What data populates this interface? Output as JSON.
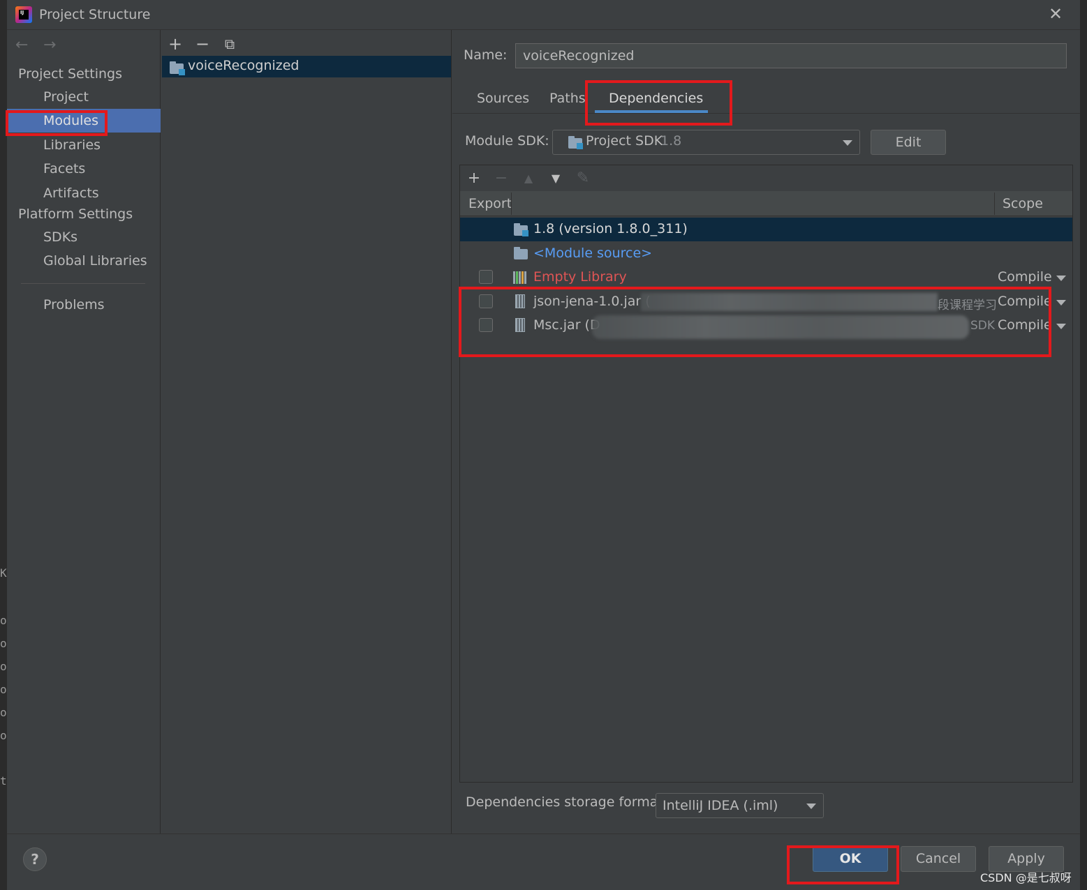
{
  "window": {
    "title": "Project Structure",
    "close_symbol": "✕"
  },
  "nav": {
    "back_symbol": "←",
    "forward_symbol": "→",
    "project_settings_header": "Project Settings",
    "project_settings_items": [
      "Project",
      "Modules",
      "Libraries",
      "Facets",
      "Artifacts"
    ],
    "platform_settings_header": "Platform Settings",
    "platform_settings_items": [
      "SDKs",
      "Global Libraries"
    ],
    "problems": "Problems",
    "selected_item": "Modules"
  },
  "modules_pane": {
    "toolbar": {
      "add_symbol": "+",
      "remove_symbol": "−",
      "copy_symbol": "⧉"
    },
    "tree": [
      {
        "label": "voiceRecognized",
        "selected": true
      }
    ]
  },
  "module": {
    "name_label": "Name:",
    "name_value": "voiceRecognized",
    "tabs": [
      "Sources",
      "Paths",
      "Dependencies"
    ],
    "active_tab": "Dependencies",
    "sdk_label": "Module SDK:",
    "sdk_value": "Project SDK",
    "sdk_version": "1.8",
    "edit_button": "Edit"
  },
  "dependencies": {
    "toolbar": {
      "add": "+",
      "remove": "−",
      "up": "▲",
      "down": "▼",
      "edit": "✎"
    },
    "columns": [
      "Export",
      "Scope"
    ],
    "rows": [
      {
        "label": "1.8 (version 1.8.0_311)",
        "type": "sdk",
        "checkbox": false,
        "scope": "",
        "selected": true
      },
      {
        "label": "<Module source>",
        "type": "source",
        "checkbox": false,
        "scope": ""
      },
      {
        "label": "Empty Library",
        "type": "library",
        "checkbox": true,
        "scope": "Compile"
      },
      {
        "label": "json-jena-1.0.jar (",
        "type": "jar",
        "checkbox": true,
        "scope": "Compile",
        "path_tail": "段课程学习"
      },
      {
        "label": "Msc.jar (D",
        "type": "jar",
        "checkbox": true,
        "scope": "Compile",
        "path_tail": "SDK"
      }
    ],
    "storage_label": "Dependencies storage format:",
    "storage_value": "IntelliJ IDEA (.iml)"
  },
  "footer": {
    "help": "?",
    "ok": "OK",
    "cancel": "Cancel",
    "apply": "Apply"
  },
  "colors": {
    "accent_selection": "#4b6eaf",
    "tree_selection": "#0d293e",
    "tab_underline": "#4a88c7",
    "module_source_link": "#589df6",
    "empty_library_red": "#e05555",
    "highlight_boxes": "#e3191c"
  },
  "icons": [
    "intellij-logo-icon",
    "close-icon",
    "back-arrow-icon",
    "forward-arrow-icon",
    "folder-icon",
    "jar-icon",
    "library-icon",
    "help-icon"
  ],
  "watermark": "CSDN @是七叔呀",
  "background_strip_text": [
    "K",
    "o",
    "o",
    "o",
    "o",
    "o",
    "o",
    "t"
  ]
}
